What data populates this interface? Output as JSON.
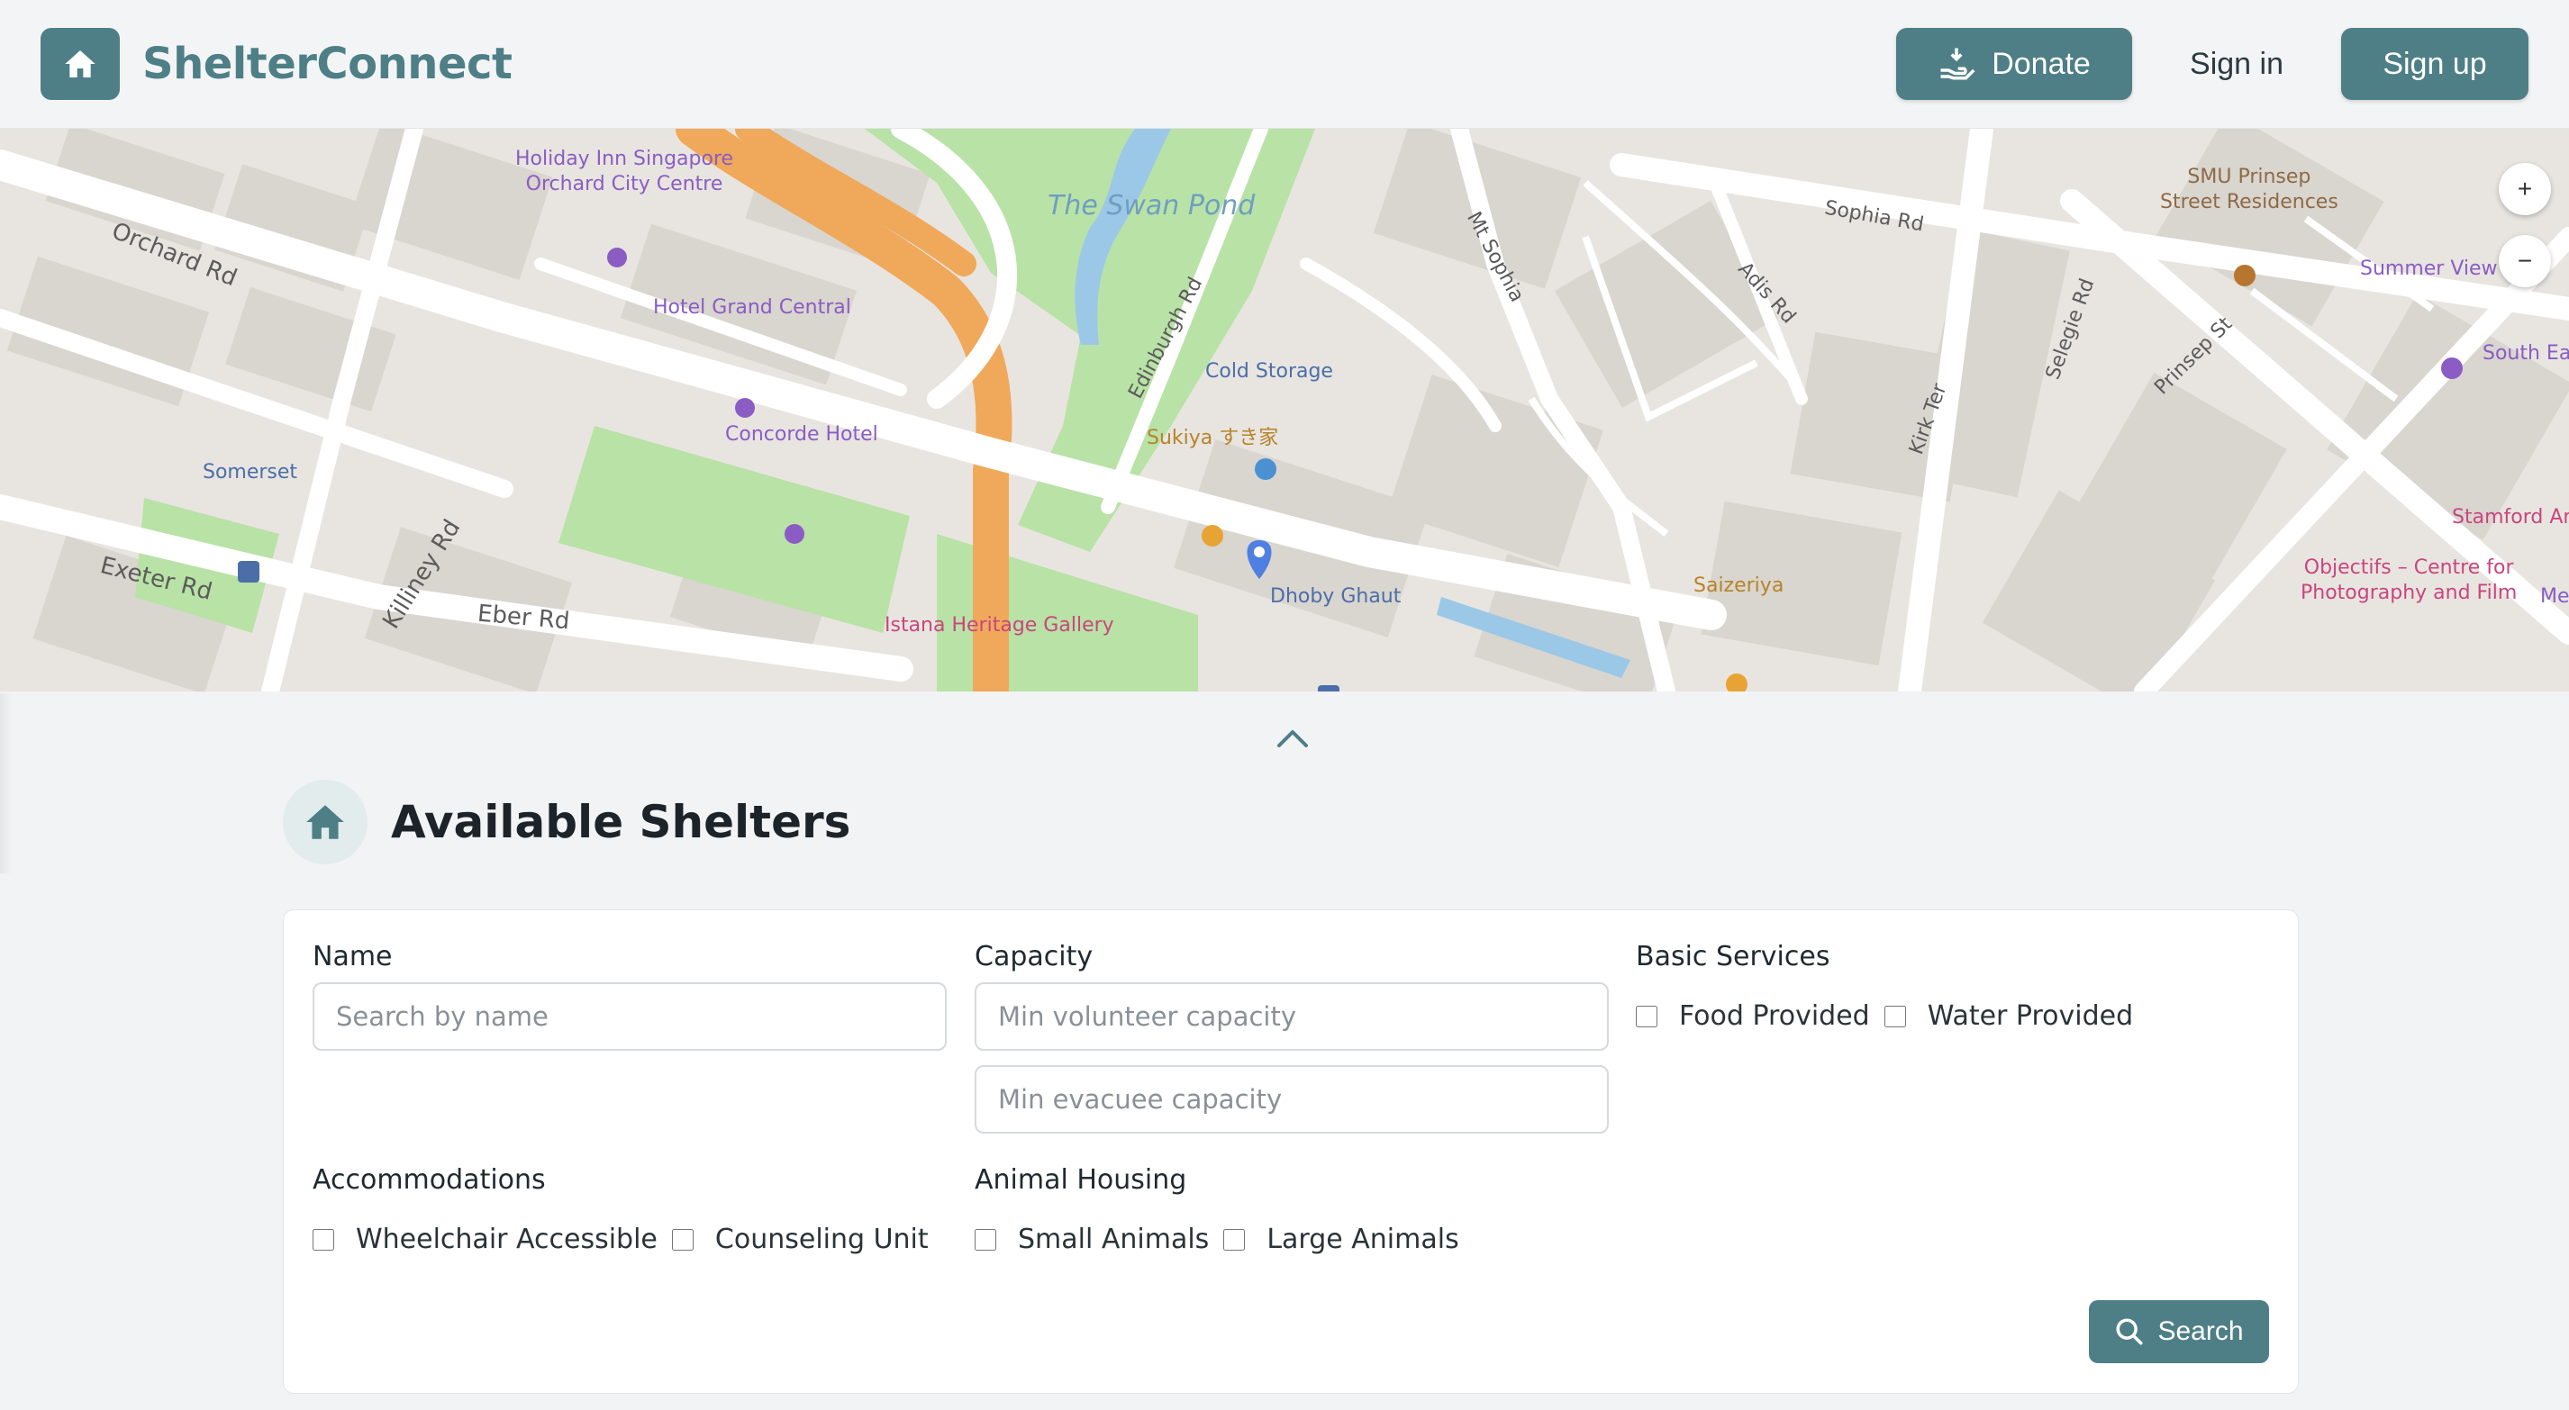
{
  "header": {
    "brand": "ShelterConnect",
    "donate_label": "Donate",
    "signin_label": "Sign in",
    "signup_label": "Sign up"
  },
  "map": {
    "zoom_in": "+",
    "zoom_out": "−",
    "streets": [
      "Orchard Rd",
      "Exeter Rd",
      "Killiney Rd",
      "Eber Rd",
      "Edinburgh Rd",
      "Mt Sophia",
      "Sophia Rd",
      "Adis Rd",
      "Kirk Ter",
      "Selegie Rd",
      "Prinsep St"
    ],
    "water": "The Swan Pond",
    "pois": {
      "holiday_inn": "Holiday Inn Singapore\nOrchard City Centre",
      "hotel_grand_central": "Hotel Grand Central",
      "concorde": "Concorde Hotel",
      "somerset": "Somerset",
      "cold_storage": "Cold Storage",
      "sukiya": "Sukiya すき家",
      "dhoby_ghaut": "Dhoby Ghaut",
      "istana": "Istana Heritage Gallery",
      "saizeriya": "Saizeriya",
      "smu": "SMU Prinsep\nStreet Residences",
      "summer_view": "Summer View I",
      "south_east": "South Eas",
      "stamford": "Stamford Ar",
      "objectifs": "Objectifs – Centre for\nPhotography and Film",
      "me": "Me"
    }
  },
  "section": {
    "title": "Available Shelters"
  },
  "filters": {
    "name_label": "Name",
    "name_placeholder": "Search by name",
    "capacity_label": "Capacity",
    "volunteer_placeholder": "Min volunteer capacity",
    "evacuee_placeholder": "Min evacuee capacity",
    "basic_services_label": "Basic Services",
    "food_label": "Food Provided",
    "water_label": "Water Provided",
    "accommodations_label": "Accommodations",
    "wheelchair_label": "Wheelchair Accessible",
    "counseling_label": "Counseling Unit",
    "animal_label": "Animal Housing",
    "small_animals_label": "Small Animals",
    "large_animals_label": "Large Animals",
    "search_label": "Search"
  },
  "colors": {
    "accent": "#4e7f86",
    "park": "#a9d89a",
    "road": "#ffffff",
    "highway": "#f0a85a",
    "water": "#9cc8e8"
  }
}
